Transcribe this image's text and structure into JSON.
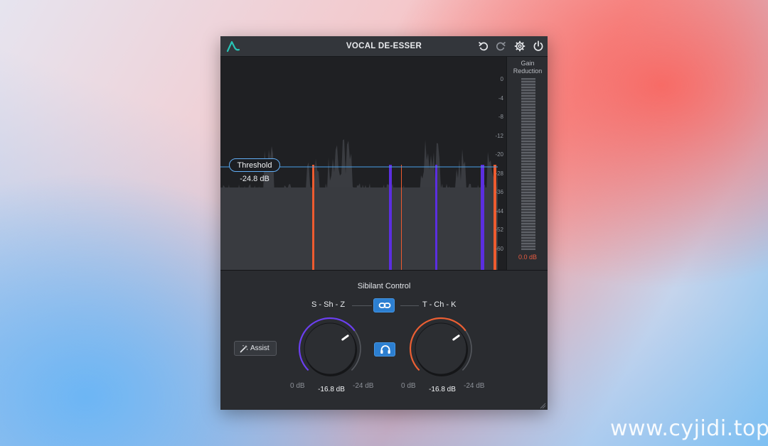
{
  "plugin": {
    "title": "VOCAL DE-ESSER",
    "icons": [
      "logo-icon",
      "undo-icon",
      "redo-icon",
      "gear-icon",
      "power-icon"
    ],
    "accent": "#2c7fd1"
  },
  "display": {
    "threshold_label": "Threshold",
    "threshold_value": "-24.8 dB",
    "scale": [
      "0",
      "-4",
      "-8",
      "-12",
      "-20",
      "-28",
      "-36",
      "-44",
      "-52",
      "-60"
    ],
    "colors": {
      "threshold_line": "#4a9fe8",
      "sibilant_sss": "#5b2ee0",
      "sibilant_tck": "#ee5b2f"
    }
  },
  "meter": {
    "title_line1": "Gain",
    "title_line2": "Reduction",
    "value": "0.0 dB"
  },
  "controls": {
    "section_title": "Sibilant Control",
    "left_band": "S - Sh - Z",
    "right_band": "T - Ch - K",
    "link_icon": "link-icon",
    "listen_icon": "headphones-icon",
    "assist_label": "Assist",
    "assist_icon": "magic-wand-icon",
    "left_knob": {
      "min": "0 dB",
      "value": "-16.8 dB",
      "max": "-24 dB",
      "color": "#6b3ff0",
      "level": 0.7
    },
    "right_knob": {
      "min": "0 dB",
      "value": "-16.8 dB",
      "max": "-24 dB",
      "color": "#ec5f33",
      "level": 0.7
    }
  },
  "watermark": "www.cyjidi.top"
}
